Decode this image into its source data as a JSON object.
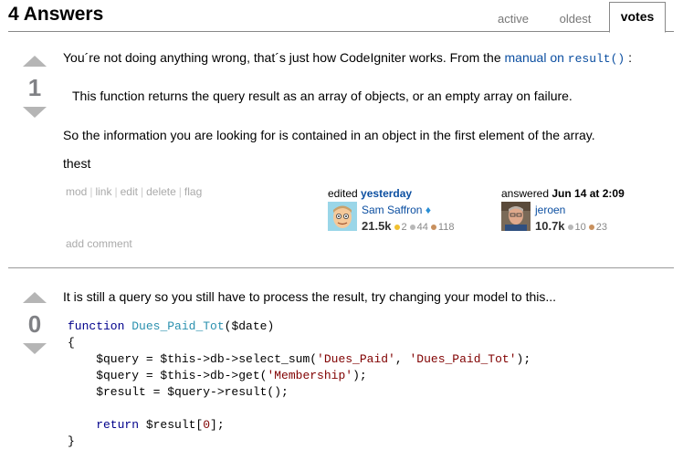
{
  "header": {
    "title": "4 Answers",
    "tabs": [
      {
        "label": "active"
      },
      {
        "label": "oldest"
      },
      {
        "label": "votes"
      }
    ]
  },
  "answer1": {
    "vote_count": "1",
    "intro_text": "You´re not doing anything wrong, that´s just how CodeIgniter works. From the",
    "intro_link": "manual on",
    "intro_link_code": "result()",
    "intro_colon": ":",
    "quote": "This function returns the query result as an array of objects, or an empty array on failure.",
    "para2": "So the information you are looking for is contained in an object in the first element of the array.",
    "para3": "thest",
    "menu": {
      "mod": "mod",
      "link": "link",
      "edit": "edit",
      "delete": "delete",
      "flag": "flag"
    },
    "editor": {
      "action": "edited",
      "time": "yesterday",
      "name": "Sam Saffron",
      "mod_diamond": "♦",
      "rep": "21.5k",
      "gold": "2",
      "silver": "44",
      "bronze": "118"
    },
    "owner": {
      "action": "answered",
      "time": "Jun 14 at 2:09",
      "name": "jeroen",
      "rep": "10.7k",
      "silver": "10",
      "bronze": "23"
    },
    "add_comment": "add comment"
  },
  "answer2": {
    "vote_count": "0",
    "text": "It is still a query so you still have to process the result, try changing your model to this...",
    "code": {
      "l1_kw": "function",
      "l1_fn": "Dues_Paid_Tot",
      "l1_rest": "($date)",
      "l2": "{",
      "l3_a": "    $query = $this->db->select_sum(",
      "l3_s1": "'Dues_Paid'",
      "l3_b": ", ",
      "l3_s2": "'Dues_Paid_Tot'",
      "l3_c": ");",
      "l4_a": "    $query = $this->db->get(",
      "l4_s": "'Membership'",
      "l4_b": ");",
      "l5": "    $result = $query->result();",
      "l6": "",
      "l7_kw": "    return",
      "l7_a": " $result[",
      "l7_n": "0",
      "l7_b": "];",
      "l8": "}"
    }
  }
}
